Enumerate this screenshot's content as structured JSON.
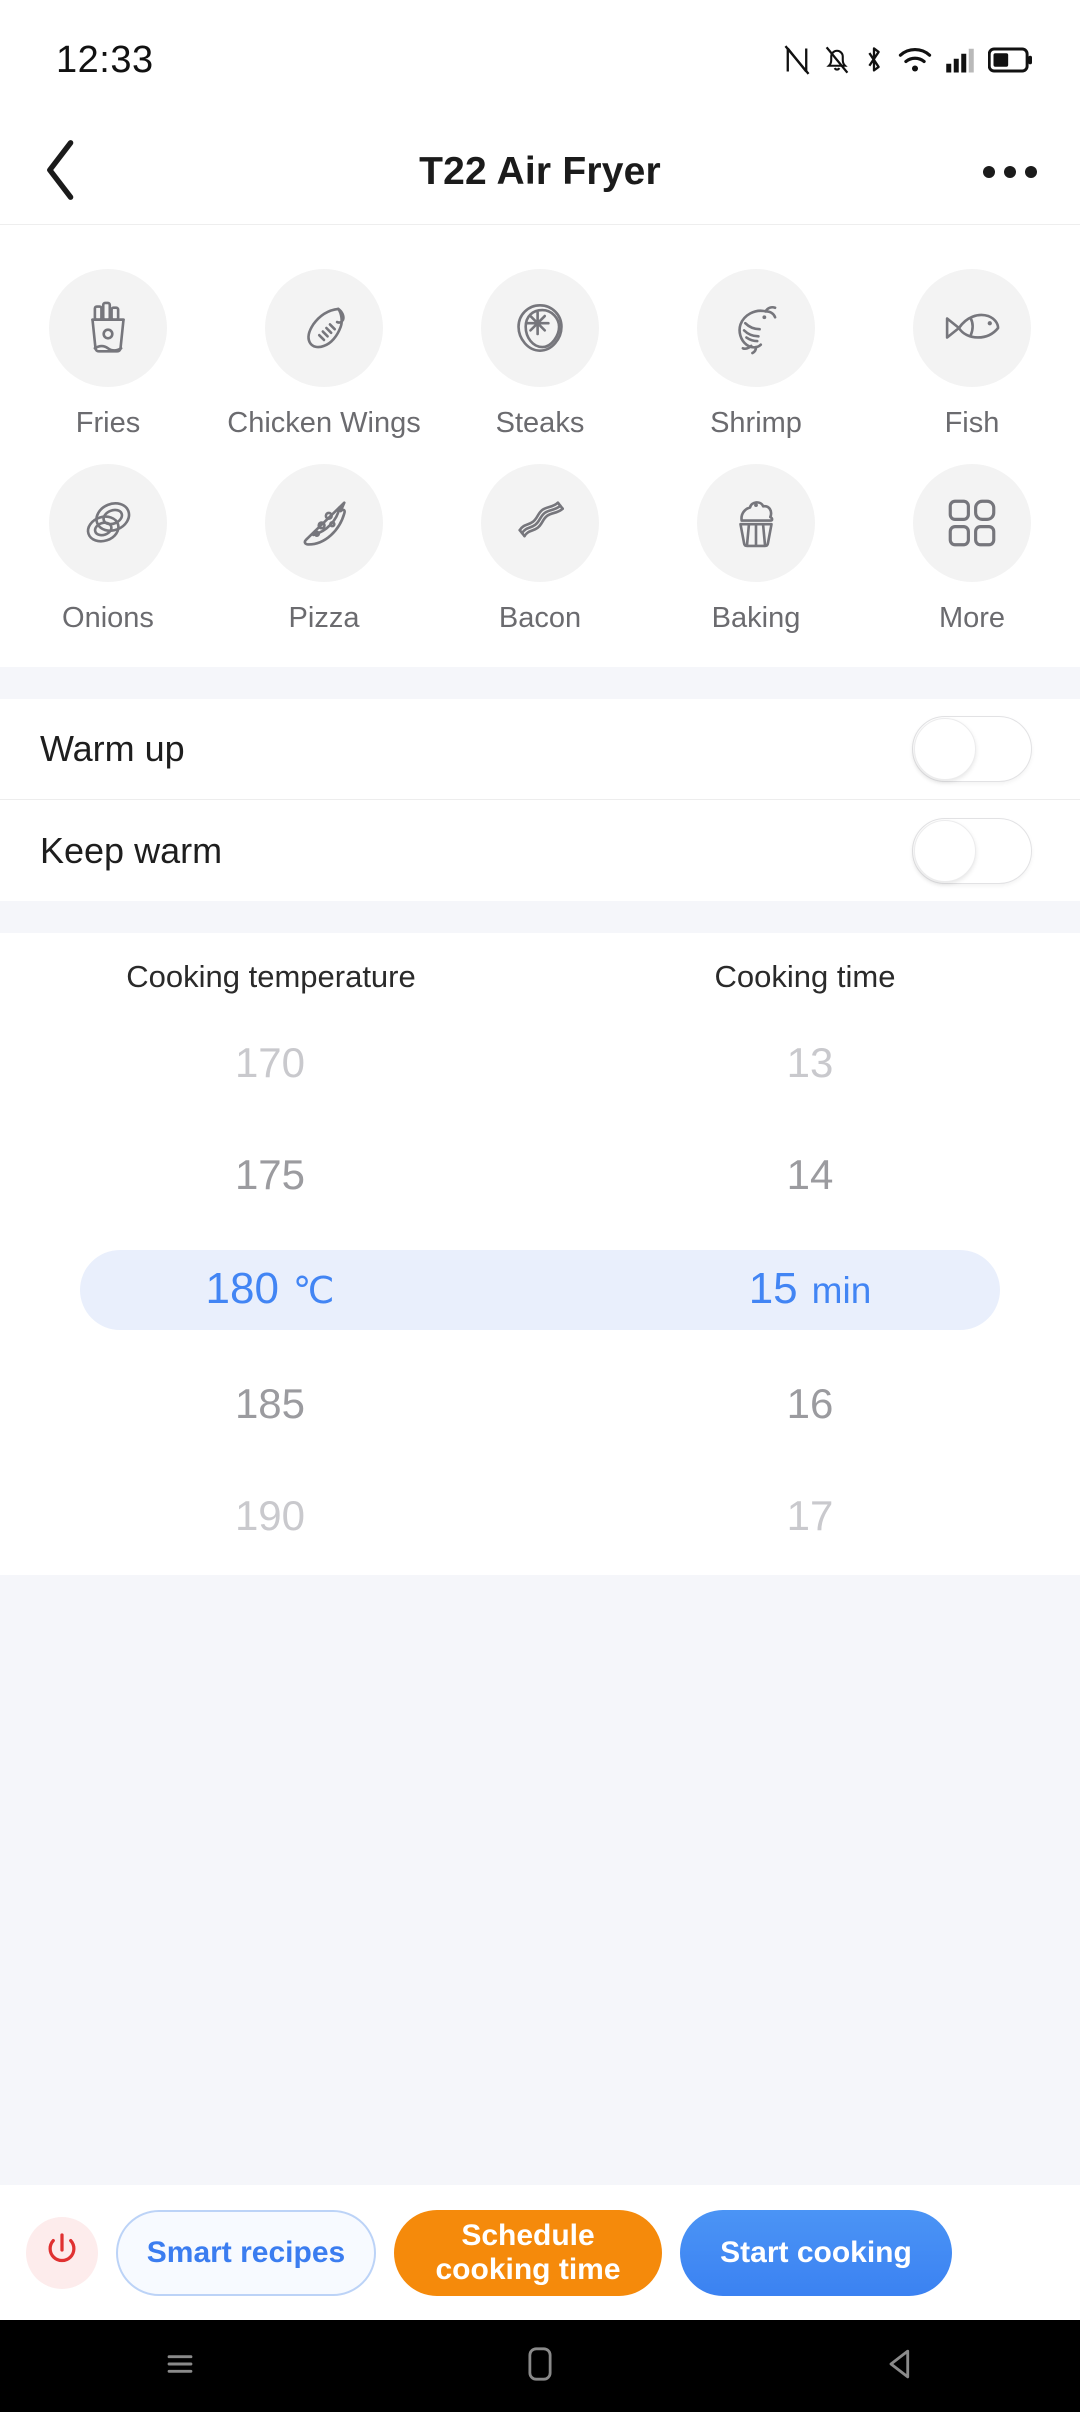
{
  "status_bar": {
    "time": "12:33",
    "icons": [
      "nfc-icon",
      "notifications-silenced-icon",
      "bluetooth-icon",
      "wifi-icon",
      "cellular-signal-icon",
      "battery-icon"
    ]
  },
  "header": {
    "back_icon": "chevron-left-icon",
    "title": "T22 Air Fryer",
    "more_icon": "more-options-icon"
  },
  "cooking_modes": [
    {
      "label": "Fries",
      "icon": "fries-icon"
    },
    {
      "label": "Chicken Wings",
      "icon": "chicken-wing-icon"
    },
    {
      "label": "Steaks",
      "icon": "steak-icon"
    },
    {
      "label": "Shrimp",
      "icon": "shrimp-icon"
    },
    {
      "label": "Fish",
      "icon": "fish-icon"
    },
    {
      "label": "Onions",
      "icon": "onion-rings-icon"
    },
    {
      "label": "Pizza",
      "icon": "pizza-icon"
    },
    {
      "label": "Bacon",
      "icon": "bacon-icon"
    },
    {
      "label": "Baking",
      "icon": "cupcake-icon"
    },
    {
      "label": "More",
      "icon": "grid-more-icon"
    }
  ],
  "settings": {
    "warm_up": {
      "label": "Warm up",
      "state": "off"
    },
    "keep_warm": {
      "label": "Keep warm",
      "state": "off"
    }
  },
  "picker": {
    "temperature": {
      "header": "Cooking temperature",
      "unit": "℃",
      "selected": "180",
      "options": [
        "170",
        "175",
        "180",
        "185",
        "190"
      ]
    },
    "time": {
      "header": "Cooking time",
      "unit": "min",
      "selected": "15",
      "options": [
        "13",
        "14",
        "15",
        "16",
        "17"
      ]
    }
  },
  "actions": {
    "power": {
      "icon": "power-icon",
      "color": "#e03131"
    },
    "smart_recipes": "Smart recipes",
    "schedule": "Schedule cooking time",
    "start": "Start cooking"
  },
  "nav_bar": {
    "recents_icon": "menu-icon",
    "home_icon": "home-square-icon",
    "back_icon": "back-triangle-icon"
  },
  "colors": {
    "accent_blue": "#4285f4",
    "selection_bg": "#e9effc",
    "orange": "#f58a0b",
    "power_red": "#e03131",
    "band_gray": "#f5f6fa"
  }
}
